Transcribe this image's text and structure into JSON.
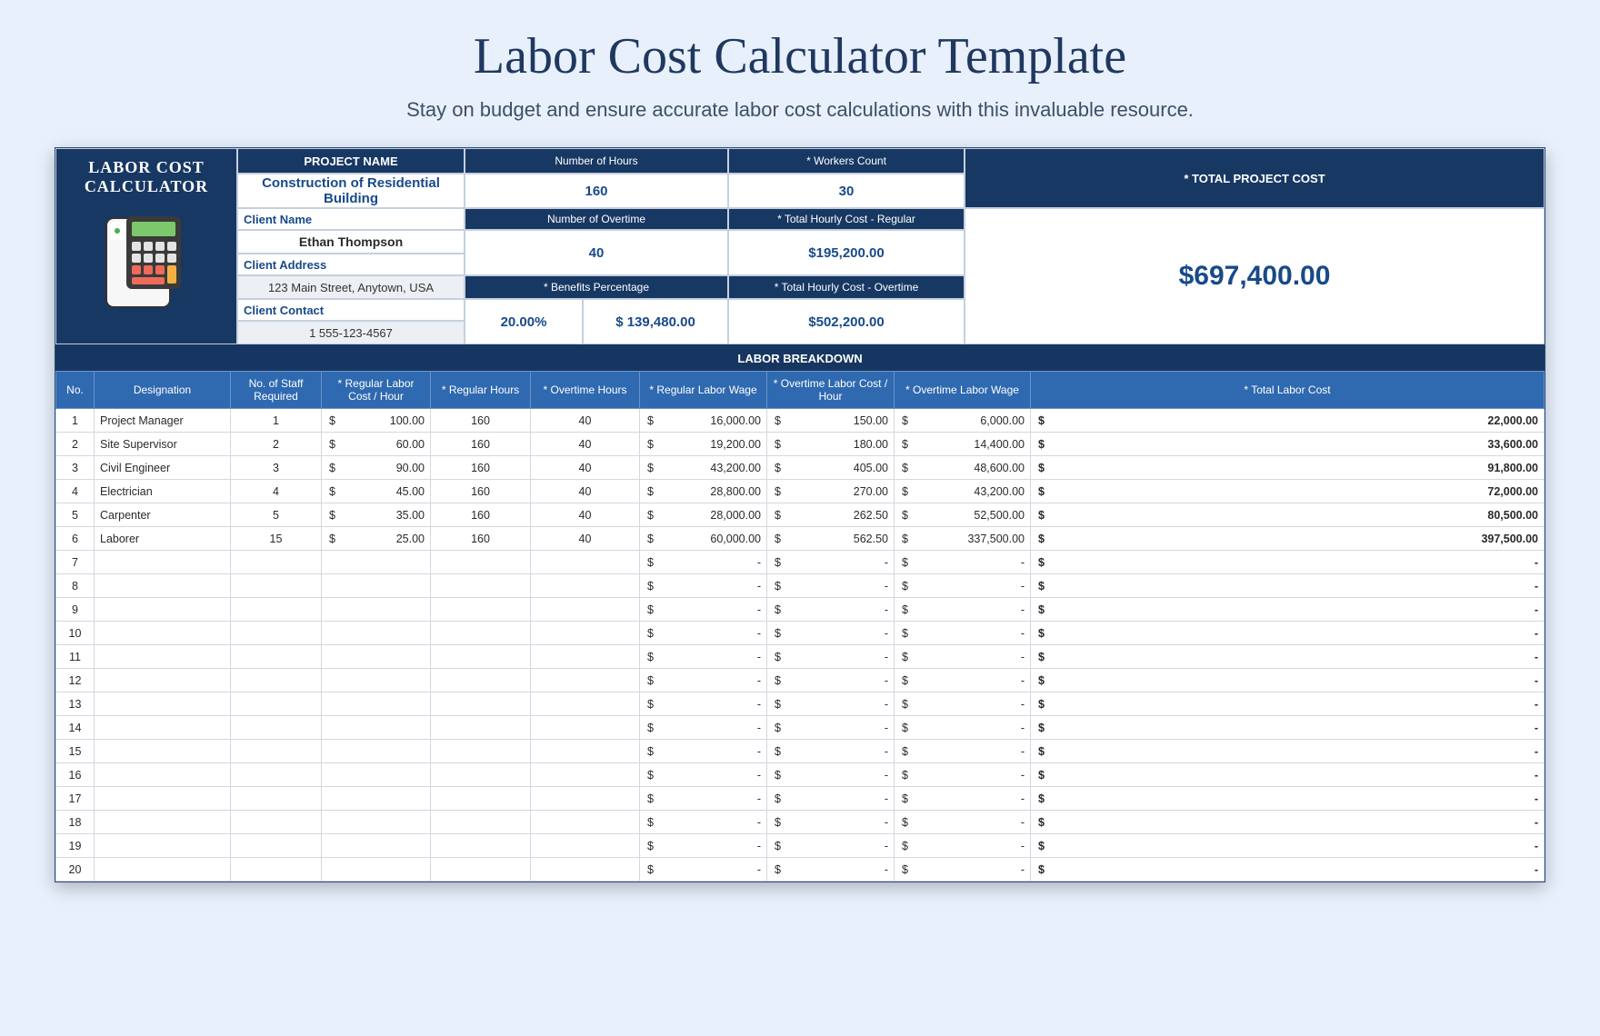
{
  "page": {
    "title": "Labor Cost Calculator Template",
    "subtitle": "Stay on budget and ensure accurate labor cost calculations with this invaluable resource."
  },
  "logo": {
    "line1": "LABOR COST",
    "line2": "CALCULATOR"
  },
  "header": {
    "project_name_label": "PROJECT NAME",
    "project_name": "Construction of Residential Building",
    "hours_label": "Number of Hours",
    "hours": "160",
    "workers_label": "* Workers Count",
    "workers": "30",
    "total_label": "* TOTAL PROJECT COST",
    "total": "$697,400.00",
    "client_name_label": "Client Name",
    "client_name": "Ethan Thompson",
    "overtime_label": "Number of Overtime",
    "overtime": "40",
    "thc_reg_label": "* Total Hourly Cost - Regular",
    "thc_reg": "$195,200.00",
    "client_addr_label": "Client Address",
    "client_addr": "123 Main Street, Anytown, USA",
    "benefits_label": "* Benefits Percentage",
    "benefits_pct": "20.00%",
    "benefits_amt": "$ 139,480.00",
    "thc_ot_label": "* Total Hourly Cost - Overtime",
    "thc_ot": "$502,200.00",
    "client_contact_label": "Client Contact",
    "client_contact": "1 555-123-4567"
  },
  "breakdown": {
    "title": "LABOR BREAKDOWN",
    "columns": [
      "No.",
      "Designation",
      "No. of Staff Required",
      "* Regular Labor Cost / Hour",
      "* Regular Hours",
      "* Overtime Hours",
      "* Regular Labor Wage",
      "* Overtime Labor Cost / Hour",
      "* Overtime Labor Wage",
      "* Total Labor Cost"
    ],
    "rows": [
      {
        "no": 1,
        "desig": "Project Manager",
        "staff": "1",
        "rate": "100.00",
        "reg_h": "160",
        "ot_h": "40",
        "reg_w": "16,000.00",
        "ot_rate": "150.00",
        "ot_w": "6,000.00",
        "total": "22,000.00"
      },
      {
        "no": 2,
        "desig": "Site Supervisor",
        "staff": "2",
        "rate": "60.00",
        "reg_h": "160",
        "ot_h": "40",
        "reg_w": "19,200.00",
        "ot_rate": "180.00",
        "ot_w": "14,400.00",
        "total": "33,600.00"
      },
      {
        "no": 3,
        "desig": "Civil Engineer",
        "staff": "3",
        "rate": "90.00",
        "reg_h": "160",
        "ot_h": "40",
        "reg_w": "43,200.00",
        "ot_rate": "405.00",
        "ot_w": "48,600.00",
        "total": "91,800.00"
      },
      {
        "no": 4,
        "desig": "Electrician",
        "staff": "4",
        "rate": "45.00",
        "reg_h": "160",
        "ot_h": "40",
        "reg_w": "28,800.00",
        "ot_rate": "270.00",
        "ot_w": "43,200.00",
        "total": "72,000.00"
      },
      {
        "no": 5,
        "desig": "Carpenter",
        "staff": "5",
        "rate": "35.00",
        "reg_h": "160",
        "ot_h": "40",
        "reg_w": "28,000.00",
        "ot_rate": "262.50",
        "ot_w": "52,500.00",
        "total": "80,500.00"
      },
      {
        "no": 6,
        "desig": "Laborer",
        "staff": "15",
        "rate": "25.00",
        "reg_h": "160",
        "ot_h": "40",
        "reg_w": "60,000.00",
        "ot_rate": "562.50",
        "ot_w": "337,500.00",
        "total": "397,500.00"
      },
      {
        "no": 7,
        "empty": true
      },
      {
        "no": 8,
        "empty": true
      },
      {
        "no": 9,
        "empty": true
      },
      {
        "no": 10,
        "empty": true
      },
      {
        "no": 11,
        "empty": true
      },
      {
        "no": 12,
        "empty": true
      },
      {
        "no": 13,
        "empty": true
      },
      {
        "no": 14,
        "empty": true
      },
      {
        "no": 15,
        "empty": true
      },
      {
        "no": 16,
        "empty": true
      },
      {
        "no": 17,
        "empty": true
      },
      {
        "no": 18,
        "empty": true
      },
      {
        "no": 19,
        "empty": true
      },
      {
        "no": 20,
        "empty": true
      }
    ]
  },
  "chart_data": {
    "type": "table",
    "title": "Labor Breakdown",
    "columns": [
      "No.",
      "Designation",
      "No. of Staff Required",
      "Regular Labor Cost / Hour",
      "Regular Hours",
      "Overtime Hours",
      "Regular Labor Wage",
      "Overtime Labor Cost / Hour",
      "Overtime Labor Wage",
      "Total Labor Cost"
    ],
    "data": [
      [
        1,
        "Project Manager",
        1,
        100.0,
        160,
        40,
        16000.0,
        150.0,
        6000.0,
        22000.0
      ],
      [
        2,
        "Site Supervisor",
        2,
        60.0,
        160,
        40,
        19200.0,
        180.0,
        14400.0,
        33600.0
      ],
      [
        3,
        "Civil Engineer",
        3,
        90.0,
        160,
        40,
        43200.0,
        405.0,
        48600.0,
        91800.0
      ],
      [
        4,
        "Electrician",
        4,
        45.0,
        160,
        40,
        28800.0,
        270.0,
        43200.0,
        72000.0
      ],
      [
        5,
        "Carpenter",
        5,
        35.0,
        160,
        40,
        28000.0,
        262.5,
        52500.0,
        80500.0
      ],
      [
        6,
        "Laborer",
        15,
        25.0,
        160,
        40,
        60000.0,
        562.5,
        337500.0,
        397500.0
      ]
    ],
    "summary": {
      "number_of_hours": 160,
      "number_of_overtime": 40,
      "workers_count": 30,
      "total_hourly_cost_regular": 195200.0,
      "total_hourly_cost_overtime": 502200.0,
      "benefits_percentage": 0.2,
      "benefits_amount": 139480.0,
      "total_project_cost": 697400.0
    }
  }
}
